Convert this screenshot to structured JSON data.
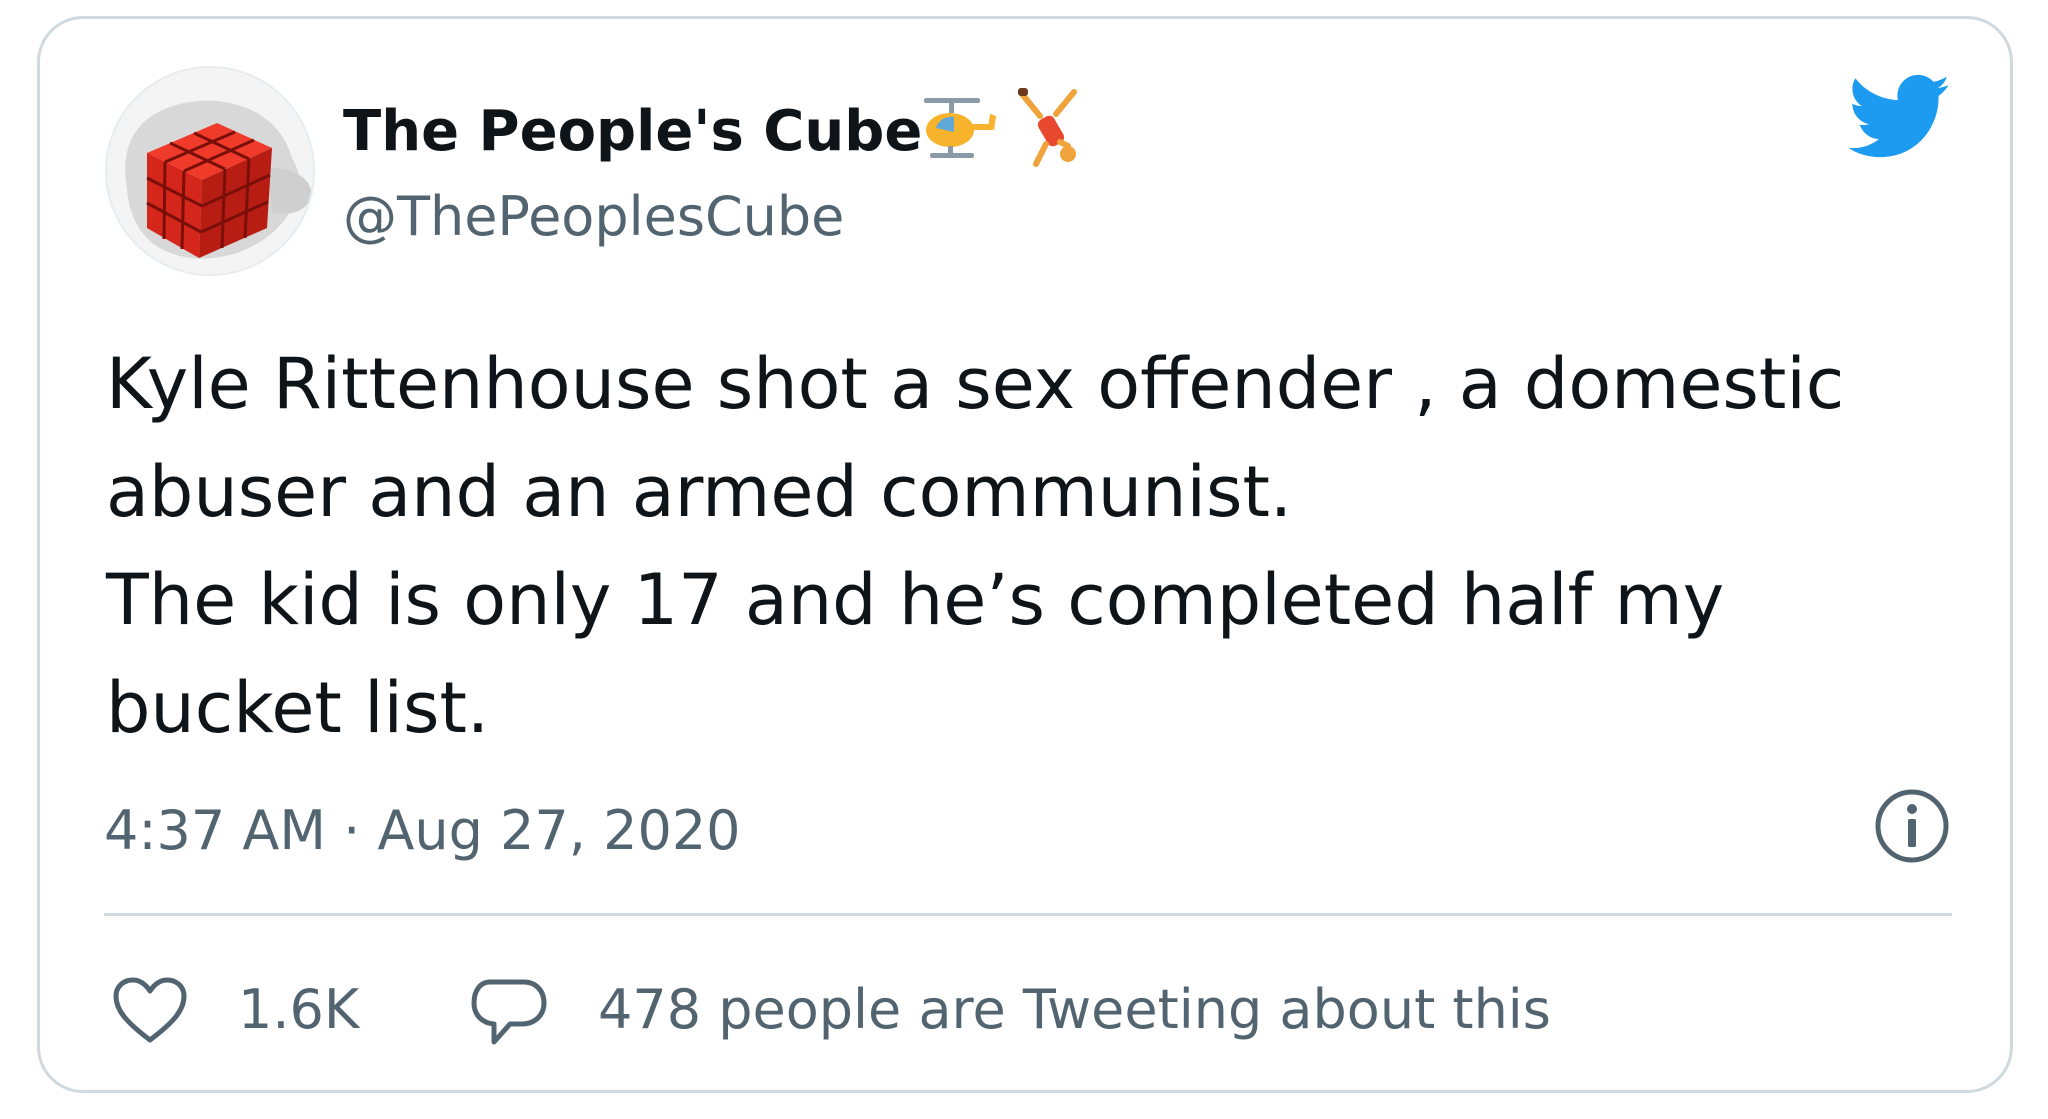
{
  "user": {
    "display_name": "The People's Cube",
    "handle": "@ThePeoplesCube",
    "name_emojis": [
      "helicopter-emoji",
      "cartwheel-emoji"
    ]
  },
  "tweet": {
    "lines": [
      "Kyle Rittenhouse shot a sex offender , a domestic",
      "abuser and an armed communist.",
      "The kid is only 17 and he’s completed half my",
      "bucket list."
    ],
    "timestamp": "4:37 AM · Aug 27, 2020"
  },
  "actions": {
    "like_count": "1.6K",
    "conversation_label": "478 people are Tweeting about this"
  },
  "colors": {
    "brand": "#1d9bf0",
    "text": "#0f1419",
    "secondary": "#536471",
    "border": "#cfd9de",
    "avatar_cube": "#e0271e"
  },
  "icons": {
    "logo": "twitter-bird-icon",
    "info": "info-icon",
    "like": "heart-icon",
    "reply": "speech-bubble-icon"
  }
}
